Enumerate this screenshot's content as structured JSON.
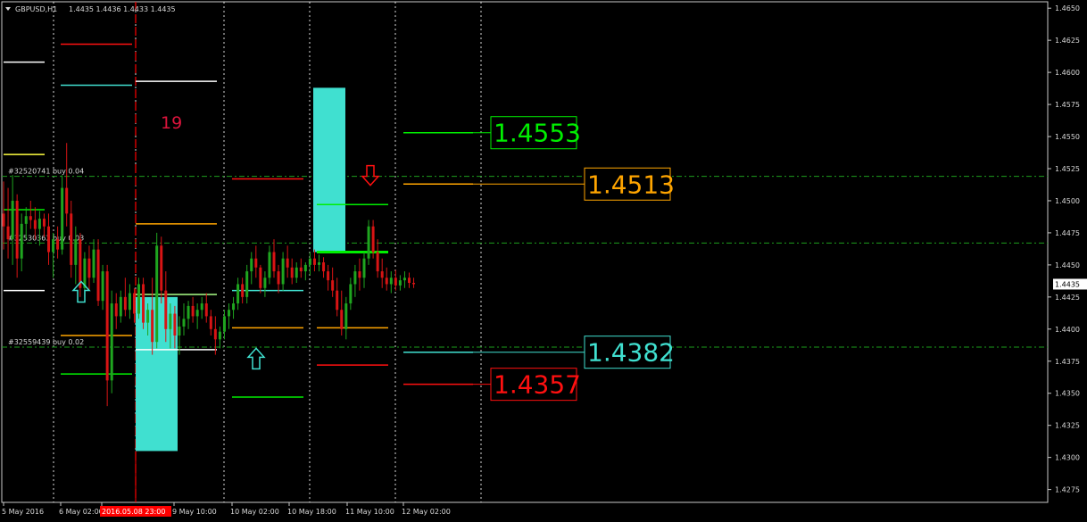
{
  "header": {
    "symbol": "GBPUSD,H1",
    "ohlc": "1.4435 1.4436 1.4433 1.4435",
    "menu_icon": "triangle-down-icon"
  },
  "colors": {
    "background": "#000000",
    "up": "#1fa51f",
    "down": "#d81414",
    "frame": "#c8c8c8",
    "grid": "#ffffff",
    "order_line": "#1d9e1d",
    "red_vline": "#ff0000",
    "aqua": "#40e0d0",
    "green": "#00ee00",
    "orange": "#ffa500",
    "red": "#ff1010",
    "white": "#ffffff",
    "yellow": "#ffff40",
    "counter": "#dc143c",
    "last_price_bg": "#ffffff",
    "last_price_text": "#000000"
  },
  "counter_label": "19",
  "orders": [
    {
      "label": "#32520741 buy 0.04",
      "price": 1.4519
    },
    {
      "label": "#32530363 buy 0.03",
      "price": 1.4467
    },
    {
      "label": "#32559439 buy 0.02",
      "price": 1.4386
    }
  ],
  "level_boxes": [
    {
      "text": "1.4553",
      "color": "#00ee00",
      "price": 1.4553
    },
    {
      "text": "1.4513",
      "color": "#ffa500",
      "price": 1.4513
    },
    {
      "text": "1.4382",
      "color": "#40e0d0",
      "price": 1.4382
    },
    {
      "text": "1.4357",
      "color": "#ff1010",
      "price": 1.4357
    }
  ],
  "arrows": [
    {
      "type": "up",
      "color": "#40e0d0",
      "at": "6 May",
      "price": 1.4428
    },
    {
      "type": "up",
      "color": "#40e0d0",
      "at": "10 May",
      "price": 1.4376
    },
    {
      "type": "down",
      "color": "#ff1010",
      "at": "11 May",
      "price": 1.4519
    }
  ],
  "zones": [
    {
      "color": "#40e0d0",
      "from": 1.4305,
      "to": 1.4425
    },
    {
      "color": "#40e0d0",
      "from": 1.446,
      "to": 1.4588
    }
  ],
  "x_labels": [
    {
      "text": "5 May 2016",
      "highlight": false
    },
    {
      "text": "6 May 02:00",
      "highlight": false
    },
    {
      "text": "2016.05.08 23:00",
      "highlight": true
    },
    {
      "text": "9 May 10:00",
      "highlight": false
    },
    {
      "text": "10 May 02:00",
      "highlight": false
    },
    {
      "text": "10 May 18:00",
      "highlight": false
    },
    {
      "text": "11 May 10:00",
      "highlight": false
    },
    {
      "text": "12 May 02:00",
      "highlight": false
    }
  ],
  "chart_data": {
    "type": "candlestick",
    "symbol": "GBPUSD",
    "timeframe": "H1",
    "ylim": [
      1.4265,
      1.4655
    ],
    "y_ticks": [
      "1.4650",
      "1.4625",
      "1.4600",
      "1.4575",
      "1.4550",
      "1.4525",
      "1.4500",
      "1.4475",
      "1.4450",
      "1.4425",
      "1.4400",
      "1.4375",
      "1.4350",
      "1.4325",
      "1.4300",
      "1.4275"
    ],
    "last_price": "1.4435",
    "x_labels": [
      "5 May 2016",
      "6 May 02:00",
      "2016.05.08 23:00",
      "9 May 10:00",
      "10 May 02:00",
      "10 May 18:00",
      "11 May 10:00",
      "12 May 02:00"
    ],
    "key_levels": [
      1.4553,
      1.4513,
      1.4382,
      1.4357
    ],
    "order_levels": [
      1.4519,
      1.4467,
      1.4386
    ],
    "ohlc": [
      [
        1.449,
        1.4515,
        1.4462,
        1.448
      ],
      [
        1.448,
        1.451,
        1.4455,
        1.447
      ],
      [
        1.447,
        1.452,
        1.445,
        1.45
      ],
      [
        1.45,
        1.4505,
        1.444,
        1.4455
      ],
      [
        1.4455,
        1.449,
        1.4445,
        1.4482
      ],
      [
        1.4482,
        1.4495,
        1.447,
        1.4488
      ],
      [
        1.4488,
        1.45,
        1.4478,
        1.4485
      ],
      [
        1.4485,
        1.4495,
        1.447,
        1.4478
      ],
      [
        1.4478,
        1.4492,
        1.4465,
        1.4486
      ],
      [
        1.4486,
        1.449,
        1.4472,
        1.448
      ],
      [
        1.448,
        1.449,
        1.445,
        1.446
      ],
      [
        1.446,
        1.4475,
        1.444,
        1.447
      ],
      [
        1.447,
        1.448,
        1.4455,
        1.4462
      ],
      [
        1.4462,
        1.452,
        1.4458,
        1.451
      ],
      [
        1.451,
        1.4545,
        1.448,
        1.449
      ],
      [
        1.449,
        1.45,
        1.444,
        1.445
      ],
      [
        1.445,
        1.448,
        1.4435,
        1.447
      ],
      [
        1.447,
        1.4475,
        1.4425,
        1.4432
      ],
      [
        1.4432,
        1.446,
        1.4425,
        1.4455
      ],
      [
        1.4455,
        1.4465,
        1.443,
        1.444
      ],
      [
        1.444,
        1.447,
        1.4436,
        1.4462
      ],
      [
        1.4462,
        1.447,
        1.4418,
        1.4422
      ],
      [
        1.4422,
        1.445,
        1.4415,
        1.4445
      ],
      [
        1.4445,
        1.445,
        1.434,
        1.436
      ],
      [
        1.436,
        1.443,
        1.435,
        1.442
      ],
      [
        1.442,
        1.4428,
        1.44,
        1.441
      ],
      [
        1.441,
        1.443,
        1.4405,
        1.4425
      ],
      [
        1.4425,
        1.444,
        1.441,
        1.4415
      ],
      [
        1.4415,
        1.4435,
        1.4408,
        1.4428
      ],
      [
        1.4428,
        1.4432,
        1.4405,
        1.4412
      ],
      [
        1.4412,
        1.444,
        1.4408,
        1.4435
      ],
      [
        1.4435,
        1.444,
        1.44,
        1.4405
      ],
      [
        1.4405,
        1.442,
        1.4395,
        1.4415
      ],
      [
        1.4415,
        1.444,
        1.438,
        1.439
      ],
      [
        1.439,
        1.4475,
        1.4385,
        1.4465
      ],
      [
        1.4465,
        1.4472,
        1.442,
        1.443
      ],
      [
        1.443,
        1.4445,
        1.439,
        1.44
      ],
      [
        1.44,
        1.442,
        1.4385,
        1.4412
      ],
      [
        1.4412,
        1.4418,
        1.4385,
        1.4395
      ],
      [
        1.4395,
        1.441,
        1.438,
        1.4402
      ],
      [
        1.4402,
        1.442,
        1.4395,
        1.4408
      ],
      [
        1.4408,
        1.4422,
        1.44,
        1.4418
      ],
      [
        1.4418,
        1.4425,
        1.4405,
        1.441
      ],
      [
        1.441,
        1.442,
        1.44,
        1.4415
      ],
      [
        1.4415,
        1.4425,
        1.4408,
        1.442
      ],
      [
        1.442,
        1.4428,
        1.4405,
        1.441
      ],
      [
        1.441,
        1.4415,
        1.4395,
        1.44
      ],
      [
        1.44,
        1.441,
        1.438,
        1.4392
      ],
      [
        1.4392,
        1.4402,
        1.4385,
        1.4398
      ],
      [
        1.4398,
        1.4415,
        1.4392,
        1.441
      ],
      [
        1.441,
        1.442,
        1.44,
        1.4415
      ],
      [
        1.4415,
        1.4425,
        1.4408,
        1.442
      ],
      [
        1.442,
        1.444,
        1.4415,
        1.4435
      ],
      [
        1.4435,
        1.444,
        1.442,
        1.4425
      ],
      [
        1.4425,
        1.445,
        1.442,
        1.4445
      ],
      [
        1.4445,
        1.446,
        1.4435,
        1.4455
      ],
      [
        1.4455,
        1.4465,
        1.444,
        1.4448
      ],
      [
        1.4448,
        1.445,
        1.4428,
        1.4432
      ],
      [
        1.4432,
        1.4445,
        1.4425,
        1.444
      ],
      [
        1.444,
        1.4465,
        1.4435,
        1.446
      ],
      [
        1.446,
        1.447,
        1.444,
        1.4445
      ],
      [
        1.4445,
        1.445,
        1.4428,
        1.4435
      ],
      [
        1.4435,
        1.446,
        1.443,
        1.4455
      ],
      [
        1.4455,
        1.4465,
        1.444,
        1.4448
      ],
      [
        1.4448,
        1.4455,
        1.4435,
        1.444
      ],
      [
        1.444,
        1.4452,
        1.4436,
        1.4448
      ],
      [
        1.4448,
        1.4455,
        1.444,
        1.4445
      ],
      [
        1.4445,
        1.4452,
        1.4438,
        1.445
      ],
      [
        1.445,
        1.446,
        1.4442,
        1.4455
      ],
      [
        1.4455,
        1.4462,
        1.4445,
        1.445
      ],
      [
        1.445,
        1.4458,
        1.4445,
        1.4452
      ],
      [
        1.4452,
        1.4456,
        1.444,
        1.4445
      ],
      [
        1.4445,
        1.445,
        1.443,
        1.4438
      ],
      [
        1.4438,
        1.4448,
        1.4425,
        1.443
      ],
      [
        1.443,
        1.444,
        1.441,
        1.4415
      ],
      [
        1.4415,
        1.443,
        1.4395,
        1.44
      ],
      [
        1.44,
        1.4425,
        1.4392,
        1.442
      ],
      [
        1.442,
        1.444,
        1.4415,
        1.4435
      ],
      [
        1.4435,
        1.445,
        1.4425,
        1.4445
      ],
      [
        1.4445,
        1.4455,
        1.443,
        1.444
      ],
      [
        1.444,
        1.446,
        1.4432,
        1.4455
      ],
      [
        1.4455,
        1.4485,
        1.445,
        1.448
      ],
      [
        1.448,
        1.4485,
        1.4455,
        1.446
      ],
      [
        1.446,
        1.447,
        1.444,
        1.4445
      ],
      [
        1.4445,
        1.4455,
        1.4432,
        1.444
      ],
      [
        1.444,
        1.4448,
        1.443,
        1.4435
      ],
      [
        1.4435,
        1.4445,
        1.4428,
        1.444
      ],
      [
        1.444,
        1.4446,
        1.443,
        1.4434
      ],
      [
        1.4434,
        1.4442,
        1.443,
        1.4438
      ],
      [
        1.4438,
        1.4445,
        1.4432,
        1.444
      ],
      [
        1.444,
        1.4444,
        1.4432,
        1.4436
      ],
      [
        1.4436,
        1.444,
        1.4432,
        1.4435
      ]
    ]
  }
}
